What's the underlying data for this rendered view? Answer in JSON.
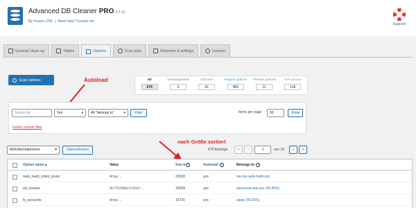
{
  "header": {
    "title_main": "Advanced DB Cleaner",
    "title_bold": "PRO",
    "version": "3.2.10",
    "author_prefix": "By",
    "author": "Younes JFR.",
    "separator": "|",
    "help_text": "Need help? Contact me",
    "support_label": "Support",
    "logo_icon": "database-icon",
    "support_icon": "lifebuoy-icon"
  },
  "tabs": [
    {
      "label": "General clean-up",
      "icon": "broom-icon",
      "active": false
    },
    {
      "label": "Tables",
      "icon": "table-icon",
      "active": false
    },
    {
      "label": "Options",
      "icon": "options-icon",
      "active": true
    },
    {
      "label": "Cron jobs",
      "icon": "clock-icon",
      "active": false
    },
    {
      "label": "Overview & settings",
      "icon": "chart-icon",
      "active": false
    },
    {
      "label": "License",
      "icon": "key-icon",
      "active": false
    }
  ],
  "scan_button": {
    "label": "Scan options",
    "icon": "search-icon"
  },
  "annotations": {
    "autoload": "Autoload",
    "sorted": "nach Größe sortiert"
  },
  "categories": [
    {
      "label": "All",
      "count": "679",
      "color": "#1d2327"
    },
    {
      "label": "Uncategorized",
      "count": "0",
      "color": "#787c82"
    },
    {
      "label": "Orphans",
      "count": "61",
      "color": "#e8734b"
    },
    {
      "label": "Plugins options",
      "count": "489",
      "color": "#2f9ee8"
    },
    {
      "label": "Themes options",
      "count": "11",
      "color": "#4caf50"
    },
    {
      "label": "WP options",
      "count": "118",
      "color": "#d970cf"
    }
  ],
  "filters": {
    "search_placeholder": "Search for",
    "autoload_value": "Yes",
    "belongs_value": "All \"belongs to\"",
    "filter_button": "Filter",
    "items_per_page_label": "Items per page",
    "items_per_page_value": "50",
    "show_button": "Show",
    "delete_custom_filter": "Delete custom filter"
  },
  "toolbar": {
    "bulk_actions": "Mehrfachaktionen",
    "apply": "Übernehmen",
    "entries": "679 Einträge",
    "first": "«",
    "prev": "‹",
    "current_page": "1",
    "of_pages": "von 14",
    "next": "›",
    "last": "»"
  },
  "table": {
    "columns": {
      "option_name": "Option name",
      "value": "Value",
      "size": "Size",
      "autoload": "Autoload",
      "belongs_to": "Belongs to"
    },
    "rows": [
      {
        "name": "rank_math_video_posts",
        "value": "Array ...",
        "size": "23038",
        "autoload": "yes",
        "belongs": "seo-by-rank-math-pro"
      },
      {
        "name": "ad_inserter",
        "value": "ALYToSMzp7xToxO ...",
        "size": "19284",
        "autoload": "yes",
        "belongs": "advanced-ads-pro (45.45%)"
      },
      {
        "name": "fs_accounts",
        "value": "Array ...",
        "size": "15725",
        "autoload": "yes",
        "belongs": "aawp (90.91%)"
      }
    ]
  }
}
